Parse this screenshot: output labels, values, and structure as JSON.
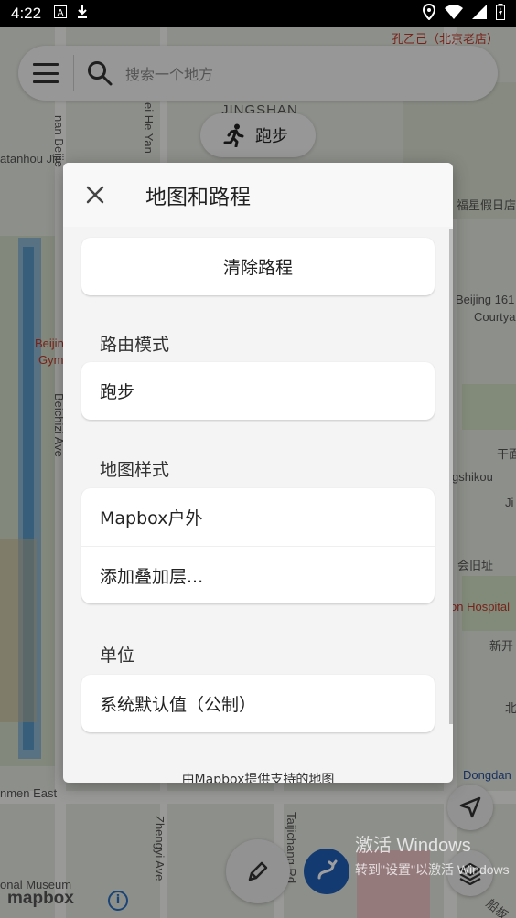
{
  "status_bar": {
    "time": "4:22",
    "icons": [
      "font-icon",
      "download-icon",
      "location-icon",
      "wifi-icon",
      "signal-icon",
      "battery-icon"
    ]
  },
  "map": {
    "labels": {
      "top_shop": "孔乙己（北京老店）",
      "jingshan": "JINGSHAN",
      "nanbeijie": "nan Beijie",
      "heyan": "ei He Yan",
      "atanhou": "atanhou Jie",
      "fuxing": "福星假日店",
      "beijing161": "Beijing 161",
      "courtya": "Courtya",
      "beijing_gym_1": "Beijin",
      "beijing_gym_2": "Gym",
      "beichizi": "Beichizi Ave",
      "qian": "干面",
      "gshikou": "gshikou",
      "ji": "Ji",
      "huizhi": "会旧址",
      "hospital": "on Hospital",
      "xinkai": "新开",
      "bei": "北",
      "dongdan": "Dongdan",
      "nmen_east": "nmen East",
      "zhengyi": "Zhengyi Ave",
      "taijichang": "Taijichang Rd",
      "national_museum": "onal Museum",
      "chuanban": "船板"
    },
    "search": {
      "placeholder": "搜索一个地方"
    },
    "activity_chip": {
      "label": "跑步"
    },
    "mapbox_logo": "mapbox",
    "info_label": "i"
  },
  "watermark": {
    "line1": "激活 Windows",
    "line2": "转到\"设置\"以激活 Windows"
  },
  "dialog": {
    "title": "地图和路程",
    "clear_route": "清除路程",
    "routing_mode_label": "路由模式",
    "routing_mode_value": "跑步",
    "map_style_label": "地图样式",
    "map_style_value": "Mapbox户外",
    "add_overlay": "添加叠加层...",
    "units_label": "单位",
    "units_value": "系统默认值（公制）",
    "footer": "由Mapbox提供支持的地图"
  },
  "colors": {
    "accent_blue": "#1f5fb8",
    "dialog_bg": "#f4f4f4",
    "scrim": "rgba(0,0,0,0.38)"
  }
}
